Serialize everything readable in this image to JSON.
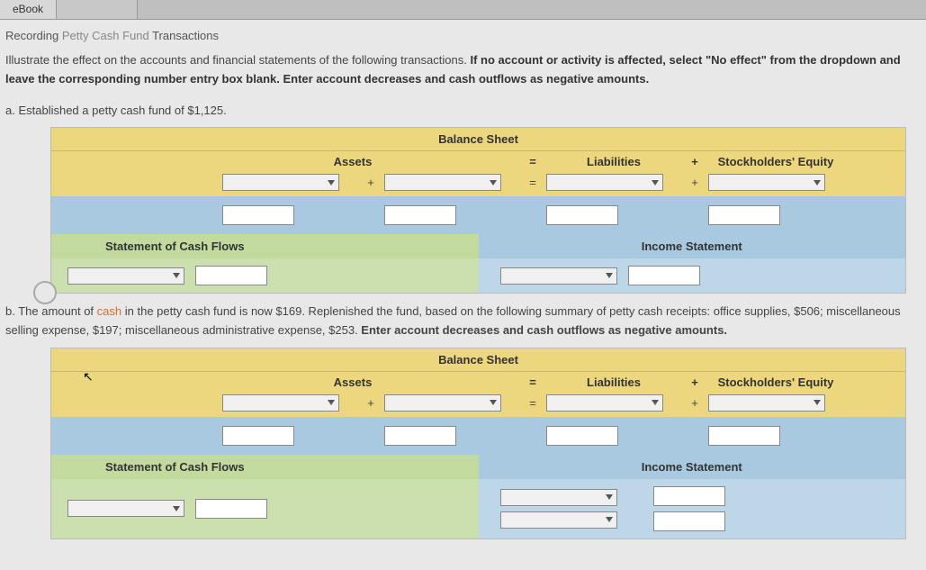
{
  "tab": "eBook",
  "subtitle_prefix": "Recording ",
  "subtitle_grey": "Petty Cash Fund",
  "subtitle_suffix": " Transactions",
  "instruction_plain": "Illustrate the effect on the accounts and financial statements of the following transactions. ",
  "instruction_bold": "If no account or activity is affected, select \"No effect\" from the dropdown and leave the corresponding number entry box blank. Enter account decreases and cash outflows as negative amounts.",
  "part_a": "a.  Established a petty cash fund of $1,125.",
  "part_b_prefix": "b.  The amount of ",
  "part_b_cash": "cash",
  "part_b_mid1": " in the petty cash fund is now $169. Replenished the fund, based on the following summary of petty cash receipts: office supplies, $506; miscellaneous selling expense, $197; miscellaneous administrative expense, $253. ",
  "part_b_bold": "Enter account decreases and cash outflows as negative amounts.",
  "labels": {
    "balance_sheet": "Balance Sheet",
    "assets": "Assets",
    "liabilities": "Liabilities",
    "stockholders_equity": "Stockholders' Equity",
    "scf": "Statement of Cash Flows",
    "is": "Income Statement",
    "eq": "=",
    "plus": "+"
  }
}
